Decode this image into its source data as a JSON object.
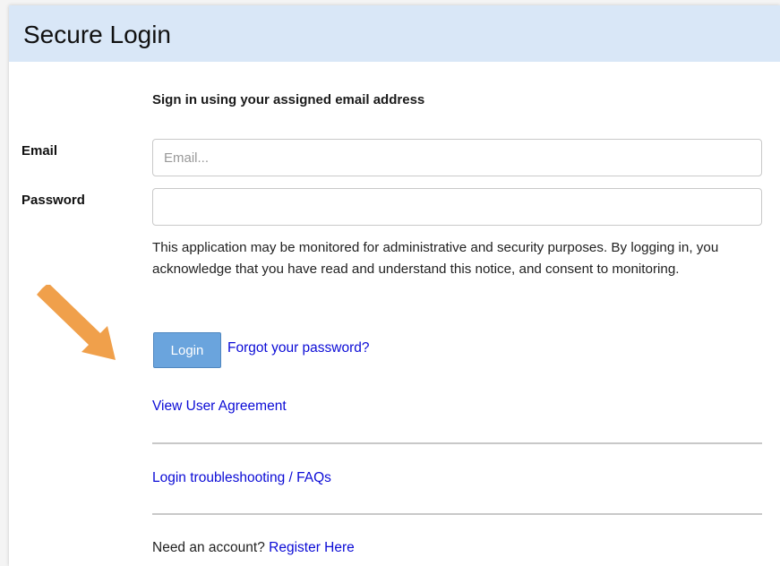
{
  "header": {
    "title": "Secure Login"
  },
  "form": {
    "instruction": "Sign in using your assigned email address",
    "email_label": "Email",
    "email_placeholder": "Email...",
    "email_value": "",
    "password_label": "Password",
    "password_value": "",
    "notice": "This application may be monitored for administrative and security purposes. By logging in, you acknowledge that you have read and understand this notice, and consent to monitoring.",
    "login_label": "Login",
    "forgot_password_label": "Forgot your password?",
    "user_agreement_label": "View User Agreement",
    "troubleshooting_label": "Login troubleshooting / FAQs",
    "account_prompt": "Need an account?",
    "register_label": "Register Here"
  },
  "annotation": {
    "icon": "arrow-pointer-icon",
    "color": "#f0a04b"
  },
  "colors": {
    "header_background": "#d9e7f7",
    "button_background": "#6aa4dd",
    "link": "#0b0bd6"
  }
}
